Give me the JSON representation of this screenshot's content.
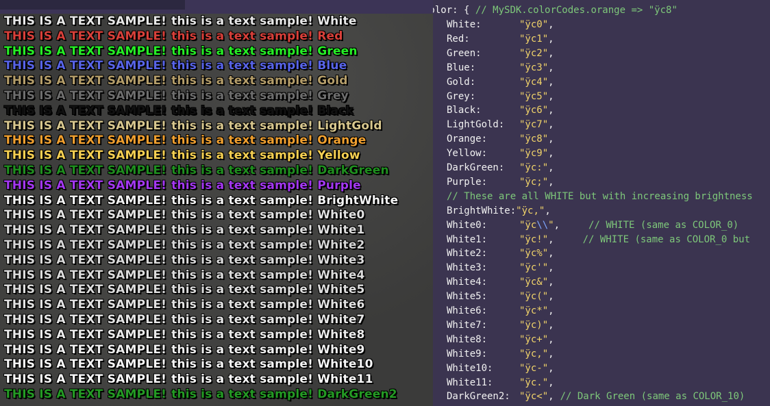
{
  "samples": {
    "caps_text": "THIS IS A TEXT SAMPLE!",
    "lower_text": "this is a text sample!",
    "rows": [
      {
        "name": "White",
        "color": "#e8e8e8"
      },
      {
        "name": "Red",
        "color": "#d8403a"
      },
      {
        "name": "Green",
        "color": "#26ee26"
      },
      {
        "name": "Blue",
        "color": "#5864e8"
      },
      {
        "name": "Gold",
        "color": "#b59e6a"
      },
      {
        "name": "Grey",
        "color": "#6e6e6e"
      },
      {
        "name": "Black",
        "color": "#111111"
      },
      {
        "name": "LightGold",
        "color": "#d8c78e"
      },
      {
        "name": "Orange",
        "color": "#f0a030"
      },
      {
        "name": "Yellow",
        "color": "#f6d052"
      },
      {
        "name": "DarkGreen",
        "color": "#1f8f1f"
      },
      {
        "name": "Purple",
        "color": "#a438f2"
      },
      {
        "name": "BrightWhite",
        "color": "#f4f4f4"
      },
      {
        "name": "White0",
        "color": "#e2e2e2"
      },
      {
        "name": "White1",
        "color": "#dedede"
      },
      {
        "name": "White2",
        "color": "#d6d6d6"
      },
      {
        "name": "White3",
        "color": "#dadada"
      },
      {
        "name": "White4",
        "color": "#dcdcdc"
      },
      {
        "name": "White5",
        "color": "#dedede"
      },
      {
        "name": "White6",
        "color": "#e2e2e2"
      },
      {
        "name": "White7",
        "color": "#e6e6e6"
      },
      {
        "name": "White8",
        "color": "#ebebeb"
      },
      {
        "name": "White9",
        "color": "#f0f0f0"
      },
      {
        "name": "White10",
        "color": "#f6f6f6"
      },
      {
        "name": "White11",
        "color": "#fbfbfb"
      },
      {
        "name": "DarkGreen2",
        "color": "#249a24"
      }
    ]
  },
  "code": {
    "header_open": "Color: {",
    "header_comment": "// MySDK.colorCodes.orange => \"ÿc8\"",
    "comment_brightness": "// These are all WHITE but with increasing brightness",
    "entries": [
      {
        "key": "White:",
        "value": "\"ÿc0\"",
        "comment": ""
      },
      {
        "key": "Red:",
        "value": "\"ÿc1\"",
        "comment": ""
      },
      {
        "key": "Green:",
        "value": "\"ÿc2\"",
        "comment": ""
      },
      {
        "key": "Blue:",
        "value": "\"ÿc3\"",
        "comment": ""
      },
      {
        "key": "Gold:",
        "value": "\"ÿc4\"",
        "comment": ""
      },
      {
        "key": "Grey:",
        "value": "\"ÿc5\"",
        "comment": ""
      },
      {
        "key": "Black:",
        "value": "\"ÿc6\"",
        "comment": ""
      },
      {
        "key": "LightGold:",
        "value": "\"ÿc7\"",
        "comment": ""
      },
      {
        "key": "Orange:",
        "value": "\"ÿc8\"",
        "comment": ""
      },
      {
        "key": "Yellow:",
        "value": "\"ÿc9\"",
        "comment": ""
      },
      {
        "key": "DarkGreen:",
        "value": "\"ÿc:\"",
        "comment": ""
      },
      {
        "key": "Purple:",
        "value": "\"ÿc;\"",
        "comment": ""
      },
      {
        "key": "BrightWhite:",
        "value": "\"ÿc,\"",
        "comment": ""
      },
      {
        "key": "White0:",
        "value": "\"ÿc\\\\\"",
        "comment": "// WHITE (same as COLOR_0)"
      },
      {
        "key": "White1:",
        "value": "\"ÿc!\"",
        "comment": "// WHITE (same as COLOR_0 but"
      },
      {
        "key": "White2:",
        "value": "\"ÿc%\"",
        "comment": ""
      },
      {
        "key": "White3:",
        "value": "\"ÿc'\"",
        "comment": ""
      },
      {
        "key": "White4:",
        "value": "\"ÿc&\"",
        "comment": ""
      },
      {
        "key": "White5:",
        "value": "\"ÿc(\"",
        "comment": ""
      },
      {
        "key": "White6:",
        "value": "\"ÿc*\"",
        "comment": ""
      },
      {
        "key": "White7:",
        "value": "\"ÿc)\"",
        "comment": ""
      },
      {
        "key": "White8:",
        "value": "\"ÿc+\"",
        "comment": ""
      },
      {
        "key": "White9:",
        "value": "\"ÿc,\"",
        "comment": ""
      },
      {
        "key": "White10:",
        "value": "\"ÿc-\"",
        "comment": ""
      },
      {
        "key": "White11:",
        "value": "\"ÿc.\"",
        "comment": ""
      },
      {
        "key": "DarkGreen2:",
        "value": "\"ÿc<\"",
        "comment": "// Dark Green (same as COLOR_10)"
      }
    ]
  }
}
